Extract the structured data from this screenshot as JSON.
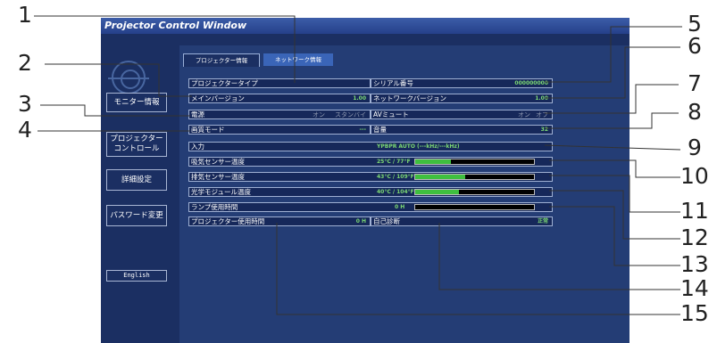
{
  "window": {
    "title": "Projector Control Window"
  },
  "sidebar": {
    "items": [
      {
        "label": "モニター情報"
      },
      {
        "label": "プロジェクター\nコントロール"
      },
      {
        "label": "詳細設定"
      },
      {
        "label": "パスワード変更"
      },
      {
        "label": "English"
      }
    ]
  },
  "tabs": [
    {
      "label": "プロジェクター情報"
    },
    {
      "label": "ネットワーク情報"
    }
  ],
  "info": {
    "projector_type_label": "プロジェクタータイプ",
    "serial_label": "シリアル番号",
    "serial_value": "000000000",
    "main_version_label": "メインバージョン",
    "main_version_value": "1.00",
    "network_version_label": "ネットワークバージョン",
    "network_version_value": "1.00",
    "power_label": "電源",
    "power_on": "オン",
    "power_standby": "スタンバイ",
    "av_mute_label": "AVミュート",
    "av_on": "オン",
    "av_off": "オフ",
    "picture_mode_label": "画質モード",
    "picture_mode_value": "---",
    "volume_label": "音量",
    "volume_value": "32",
    "input_label": "入力",
    "input_value": "YPBPR   AUTO (---kHz/---kHz)",
    "intake_label": "吸気センサー温度",
    "intake_value": "25°C / 77°F",
    "exhaust_label": "排気センサー温度",
    "exhaust_value": "43°C / 109°F",
    "optics_label": "光学モジュール温度",
    "optics_value": "40°C / 104°F",
    "lamp_label": "ランプ使用時間",
    "lamp_value": "0 H",
    "usage_label": "プロジェクター使用時間",
    "usage_value": "0 H",
    "selfdiag_label": "自己診断",
    "selfdiag_value": "正常"
  },
  "gauges": {
    "intake": 0.3,
    "exhaust": 0.42,
    "optics": 0.37,
    "lamp": 0.0
  },
  "callouts": [
    "1",
    "2",
    "3",
    "4",
    "5",
    "6",
    "7",
    "8",
    "9",
    "10",
    "11",
    "12",
    "13",
    "14",
    "15"
  ],
  "colors": {
    "frame": "#1b2f62",
    "panel": "#243d75",
    "value_green": "#7cd873",
    "bar_green": "#3fbf3f"
  }
}
